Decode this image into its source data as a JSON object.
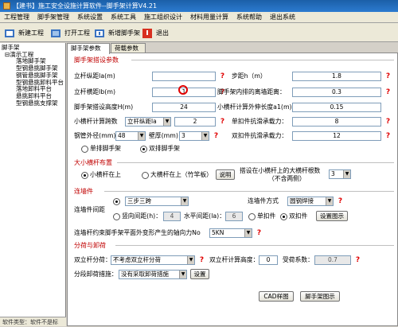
{
  "window": {
    "title": "【建书】施工安全设施计算软件--脚手架计算V4.21"
  },
  "menu": [
    "工程管理",
    "脚手架管理",
    "系统设置",
    "系统工具",
    "施工组织设计",
    "材料用量计算",
    "系统帮助",
    "退出系统"
  ],
  "toolbar": {
    "new": "新建工程",
    "open": "打开工程",
    "add_scaffold": "新增脚手架",
    "exit": "退出"
  },
  "tree": {
    "root": "脚手架",
    "project": "演示工程",
    "items": [
      "落地脚手架",
      "型钢悬挑脚手架",
      "钢管悬挑脚手架",
      "型钢悬挑卸料平台",
      "落地卸料平台",
      "悬挑卸料平台",
      "型钢悬挑支撑架"
    ]
  },
  "left_status": "软件类型：软件不是标",
  "tabs": [
    "脚手架参数",
    "荷载参数"
  ],
  "sections": {
    "params": "脚手架搭设参数",
    "small": "大小横杆布置",
    "ties": "连墙件",
    "segment": "分荷与卸荷"
  },
  "params": {
    "la_label": "立杆纵距la(m)",
    "la_value": "",
    "h_label": "步距h（m）",
    "h_value": "1.8",
    "lb_label": "立杆横距lb(m)",
    "lb_value": "1",
    "inner_label": "脚手架内排的离墙距离：",
    "inner_value": "0.3",
    "height_label": "脚手架搭设高度H(m)",
    "height_value": "24",
    "a1_label": "小横杆计算外伸长度a1(m)",
    "a1_value": "0.15",
    "small_label": "小横杆计算跨数",
    "small_select": "立杆纵距la",
    "small_value": "2",
    "single_label": "单扣件抗滑承载力：",
    "single_value": "8",
    "pipe_label": "钢管外径(mm)",
    "pipe_value": "48",
    "wall_label": "壁厚(mm)",
    "wall_value": "3",
    "double_label": "双扣件抗滑承载力：",
    "double_value": "12",
    "row_single": "单排脚手架",
    "row_double": "双排脚手架"
  },
  "small": {
    "opt1": "小横杆在上",
    "opt2": "大横杆在上（竹竿板）",
    "explain": "说明",
    "count_label": "搭设在小横杆上的大横杆根数",
    "count_sub": "（不含两侧）",
    "count_value": "3"
  },
  "ties": {
    "spacing_label": "连墙件间距",
    "spacing_select": "三步三跨",
    "method_label": "连墙件方式",
    "method_value": "圆钢焊接",
    "vertical_label": "竖向间距(h)：",
    "vertical_value": "4",
    "horizontal_label": "水平间距(la)：",
    "horizontal_value": "6",
    "single": "单扣件",
    "double": "双扣件",
    "settings": "设置图示",
    "bottom_label": "连墙杆约束脚手架平面外变形产生的轴向力No",
    "bottom_value": "5KN"
  },
  "segment": {
    "rod_label": "双立杆分荷：",
    "rod_value": "不考虑双立杆分荷",
    "calc_height_label": "双立杆计算高度：",
    "calc_height_value": "0",
    "ratio_label": "受荷系数：",
    "ratio_value": "0.7",
    "unload_label": "分段卸荷措施：",
    "unload_value": "没有采取卸荷措施",
    "unload_btn": "设置"
  },
  "footer": {
    "cad": "CAD样图",
    "diagram": "脚手架图示"
  }
}
